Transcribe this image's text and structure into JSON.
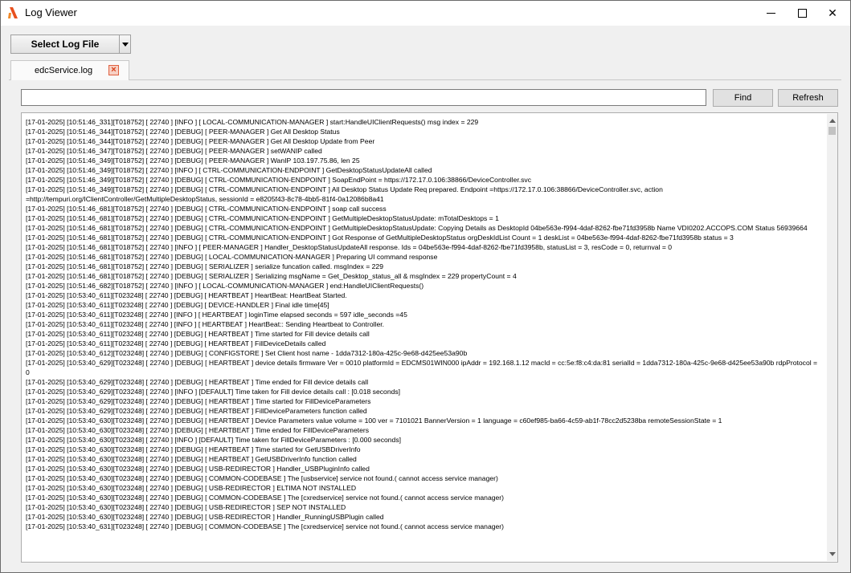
{
  "window": {
    "title": "Log Viewer",
    "icon": "app-logo-icon",
    "controls": {
      "minimize": "minimize-icon",
      "maximize": "maximize-icon",
      "close": "✕"
    }
  },
  "toolbar": {
    "select_label": "Select Log File",
    "dropdown_icon": "chevron-down-icon"
  },
  "tabs": [
    {
      "label": "edcService.log",
      "close_icon": "close-icon",
      "close_glyph": "×"
    }
  ],
  "search": {
    "value": "",
    "placeholder": "",
    "find_label": "Find",
    "refresh_label": "Refresh"
  },
  "scrollbar": {
    "up_icon": "scroll-up-icon",
    "down_icon": "scroll-down-icon"
  },
  "log_lines": [
    "[17-01-2025] [10:51:46_331][T018752] [ 22740 ] [INFO ] [ LOCAL-COMMUNICATION-MANAGER ] start:HandleUIClientRequests() msg index = 229",
    "[17-01-2025] [10:51:46_344][T018752] [ 22740 ] [DEBUG] [ PEER-MANAGER ] Get All Desktop Status",
    "[17-01-2025] [10:51:46_344][T018752] [ 22740 ] [DEBUG] [ PEER-MANAGER ] Get All Desktop Update from Peer",
    "[17-01-2025] [10:51:46_347][T018752] [ 22740 ] [DEBUG] [ PEER-MANAGER ] setWANIP called",
    "[17-01-2025] [10:51:46_349][T018752] [ 22740 ] [DEBUG] [ PEER-MANAGER ] WanIP 103.197.75.86, len 25",
    "[17-01-2025] [10:51:46_349][T018752] [ 22740 ] [INFO ] [ CTRL-COMMUNICATION-ENDPOINT ] GetDesktopStatusUpdateAll called",
    "[17-01-2025] [10:51:46_349][T018752] [ 22740 ] [DEBUG] [ CTRL-COMMUNICATION-ENDPOINT ] SoapEndPoint = https://172.17.0.106:38866/DeviceController.svc",
    "[17-01-2025] [10:51:46_349][T018752] [ 22740 ] [DEBUG] [ CTRL-COMMUNICATION-ENDPOINT ] All Desktop Status Update Req prepared. Endpoint =https://172.17.0.106:38866/DeviceController.svc, action =http://tempuri.org/IClientController/GetMultipleDesktopStatus, sessionId = e8205f43-8c78-4bb5-81f4-0a12086b8a41",
    "[17-01-2025] [10:51:46_681][T018752] [ 22740 ] [DEBUG] [ CTRL-COMMUNICATION-ENDPOINT ] soap call success",
    "[17-01-2025] [10:51:46_681][T018752] [ 22740 ] [DEBUG] [ CTRL-COMMUNICATION-ENDPOINT ] GetMultipleDesktopStatusUpdate: mTotalDesktops = 1",
    "[17-01-2025] [10:51:46_681][T018752] [ 22740 ] [DEBUG] [ CTRL-COMMUNICATION-ENDPOINT ] GetMultipleDesktopStatusUpdate: Copying Details as DesktopId 04be563e-f994-4daf-8262-fbe71fd3958b Name VDI0202.ACCOPS.COM Status 56939664",
    "[17-01-2025] [10:51:46_681][T018752] [ 22740 ] [DEBUG] [ CTRL-COMMUNICATION-ENDPOINT ] Got Response of GetMultipleDesktopStatus orgDeskIdList Count = 1 deskList = 04be563e-f994-4daf-8262-fbe71fd3958b status = 3",
    "[17-01-2025] [10:51:46_681][T018752] [ 22740 ] [INFO ] [ PEER-MANAGER ] Handler_DesktopStatusUpdateAll response. Ids = 04be563e-f994-4daf-8262-fbe71fd3958b, statusList = 3, resCode = 0, returnval = 0",
    "[17-01-2025] [10:51:46_681][T018752] [ 22740 ] [DEBUG] [ LOCAL-COMMUNICATION-MANAGER ] Preparing UI command response",
    "[17-01-2025] [10:51:46_681][T018752] [ 22740 ] [DEBUG] [ SERIALIZER ] serialize funcation called. msgIndex = 229",
    "[17-01-2025] [10:51:46_681][T018752] [ 22740 ] [DEBUG] [ SERIALIZER ] Serializing msgName = Get_Desktop_status_all & msgIndex = 229 propertyCount = 4",
    "[17-01-2025] [10:51:46_682][T018752] [ 22740 ] [INFO ] [ LOCAL-COMMUNICATION-MANAGER ] end:HandleUIClientRequests()",
    "[17-01-2025] [10:53:40_611][T023248] [ 22740 ] [DEBUG] [ HEARTBEAT ] HeartBeat: HeartBeat Started.",
    "[17-01-2025] [10:53:40_611][T023248] [ 22740 ] [DEBUG] [ DEVICE-HANDLER ] Final idle time[45]",
    "[17-01-2025] [10:53:40_611][T023248] [ 22740 ] [INFO ] [ HEARTBEAT ] loginTime elapsed seconds = 597 idle_seconds =45",
    "[17-01-2025] [10:53:40_611][T023248] [ 22740 ] [INFO ] [ HEARTBEAT ] HeartBeat:: Sending Heartbeat to Controller.",
    "[17-01-2025] [10:53:40_611][T023248] [ 22740 ] [DEBUG] [ HEARTBEAT ] Time started for Fill device details call",
    "[17-01-2025] [10:53:40_611][T023248] [ 22740 ] [DEBUG] [ HEARTBEAT ] FillDeviceDetails called",
    "[17-01-2025] [10:53:40_612][T023248] [ 22740 ] [DEBUG] [ CONFIGSTORE ] Set Client host name - 1dda7312-180a-425c-9e68-d425ee53a90b",
    "[17-01-2025] [10:53:40_629][T023248] [ 22740 ] [DEBUG] [ HEARTBEAT ] device details firmware Ver = 0010 platformId = EDCMS01WIN000 ipAddr = 192.168.1.12 macId = cc:5e:f8:c4:da:81 serialId = 1dda7312-180a-425c-9e68-d425ee53a90b rdpProtocol = 0",
    "[17-01-2025] [10:53:40_629][T023248] [ 22740 ] [DEBUG] [ HEARTBEAT ] Time ended for Fill device details call",
    "[17-01-2025] [10:53:40_629][T023248] [ 22740 ] [INFO ] [DEFAULT] Time taken for Fill device details call : [0.018 seconds]",
    "[17-01-2025] [10:53:40_629][T023248] [ 22740 ] [DEBUG] [ HEARTBEAT ] Time started for FillDeviceParameters",
    "[17-01-2025] [10:53:40_629][T023248] [ 22740 ] [DEBUG] [ HEARTBEAT ] FillDeviceParameters function called",
    "[17-01-2025] [10:53:40_630][T023248] [ 22740 ] [DEBUG] [ HEARTBEAT ] Device Parameters value volume = 100 ver = 7101021 BannerVersion = 1 language = c60ef985-ba66-4c59-ab1f-78cc2d5238ba remoteSessionState = 1",
    "[17-01-2025] [10:53:40_630][T023248] [ 22740 ] [DEBUG] [ HEARTBEAT ] Time ended for FillDeviceParameters",
    "[17-01-2025] [10:53:40_630][T023248] [ 22740 ] [INFO ] [DEFAULT] Time taken for FillDeviceParameters : [0.000 seconds]",
    "[17-01-2025] [10:53:40_630][T023248] [ 22740 ] [DEBUG] [ HEARTBEAT ] Time started for GetUSBDriverInfo",
    "[17-01-2025] [10:53:40_630][T023248] [ 22740 ] [DEBUG] [ HEARTBEAT ] GetUSBDriverInfo function called",
    "[17-01-2025] [10:53:40_630][T023248] [ 22740 ] [DEBUG] [ USB-REDIRECTOR ] Handler_USBPluginInfo called",
    "[17-01-2025] [10:53:40_630][T023248] [ 22740 ] [DEBUG] [ COMMON-CODEBASE ] The [usbservice] service not found.( cannot access service manager)",
    "[17-01-2025] [10:53:40_630][T023248] [ 22740 ] [DEBUG] [ USB-REDIRECTOR ] ELTIMA NOT INSTALLED",
    "[17-01-2025] [10:53:40_630][T023248] [ 22740 ] [DEBUG] [ COMMON-CODEBASE ] The [cxredservice] service not found.( cannot access service manager)",
    "[17-01-2025] [10:53:40_630][T023248] [ 22740 ] [DEBUG] [ USB-REDIRECTOR ] SEP NOT INSTALLED",
    "[17-01-2025] [10:53:40_630][T023248] [ 22740 ] [DEBUG] [ USB-REDIRECTOR ] Handler_RunningUSBPlugin called",
    "[17-01-2025] [10:53:40_631][T023248] [ 22740 ] [DEBUG] [ COMMON-CODEBASE ] The [cxredservice] service not found.( cannot access service manager)"
  ]
}
